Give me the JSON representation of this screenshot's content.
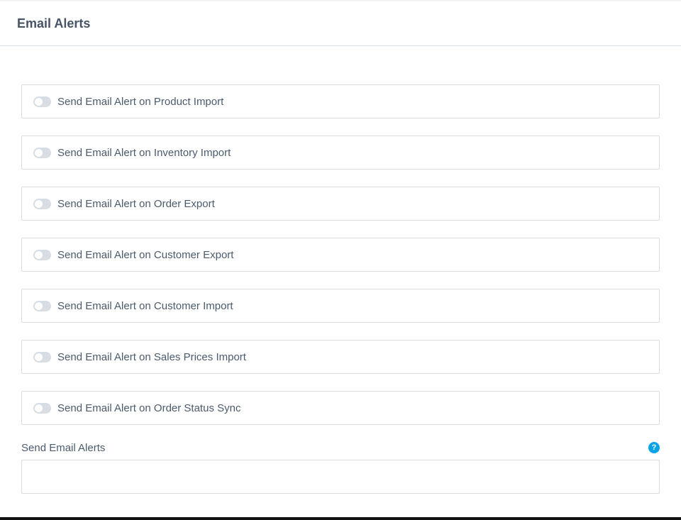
{
  "header": {
    "title": "Email Alerts"
  },
  "toggles": [
    {
      "label": "Send Email Alert on Product Import",
      "enabled": false
    },
    {
      "label": "Send Email Alert on Inventory Import",
      "enabled": false
    },
    {
      "label": "Send Email Alert on Order Export",
      "enabled": false
    },
    {
      "label": "Send Email Alert on Customer Export",
      "enabled": false
    },
    {
      "label": "Send Email Alert on Customer Import",
      "enabled": false
    },
    {
      "label": "Send Email Alert on Sales Prices Import",
      "enabled": false
    },
    {
      "label": "Send Email Alert on Order Status Sync",
      "enabled": false
    }
  ],
  "email_field": {
    "label": "Send Email Alerts",
    "value": "",
    "help_icon": "question-circle-icon",
    "help_glyph": "?"
  },
  "colors": {
    "help_icon": "#0aa3e6",
    "switch_off": "#d7dde3"
  }
}
